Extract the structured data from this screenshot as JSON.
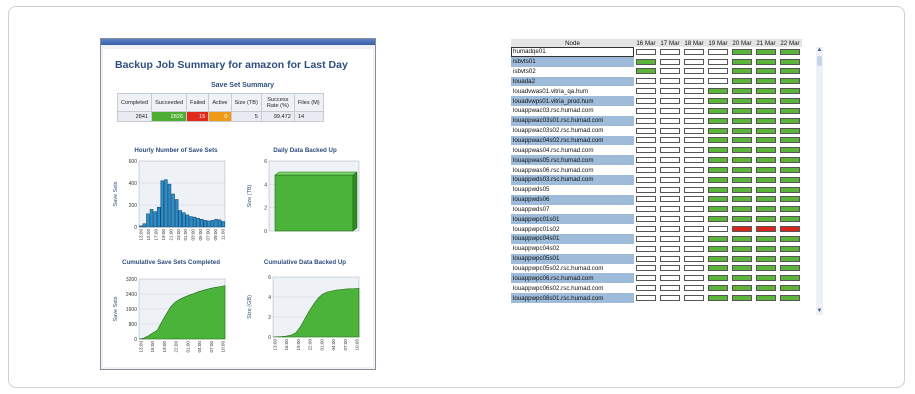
{
  "report": {
    "title": "Backup Job Summary for amazon for Last Day",
    "summary_title": "Save Set Summary",
    "summary_headers": [
      "Completed",
      "Succeeded",
      "Failed",
      "Active",
      "Size (TB)",
      "Success Rate (%)",
      "Files (M)"
    ],
    "summary_values": [
      "2841",
      "2826",
      "15",
      "0",
      "5",
      "99.472",
      "14"
    ],
    "status_colors": {
      "succeeded": "#4cae33",
      "failed": "#e02a1c",
      "active": "#ef9a16"
    }
  },
  "chart_data": [
    {
      "type": "bar",
      "title": "Hourly Number of Save Sets",
      "ylabel": "Save Sets",
      "ylim": [
        0,
        600
      ],
      "yticks": [
        "600",
        "400",
        "200",
        "0"
      ],
      "categories": [
        "13:00",
        "14:00",
        "15:00",
        "16:00",
        "17:00",
        "18:00",
        "19:00",
        "20:00",
        "21:00",
        "22:00",
        "23:00",
        "00:00",
        "01:00",
        "02:00",
        "03:00",
        "04:00",
        "05:00",
        "06:00",
        "07:00",
        "08:00",
        "09:00",
        "10:00",
        "11:00",
        "12:00"
      ],
      "xtick_labels": [
        "13:00",
        "15:00",
        "17:00",
        "19:00",
        "21:00",
        "23:00",
        "01:00",
        "03:00",
        "05:00",
        "07:00",
        "09:00",
        "11:00"
      ],
      "values": [
        10,
        30,
        120,
        160,
        140,
        180,
        420,
        430,
        390,
        300,
        250,
        150,
        130,
        110,
        95,
        90,
        80,
        70,
        60,
        55,
        60,
        70,
        65,
        50
      ]
    },
    {
      "type": "bar",
      "title": "Daily Data Backed Up",
      "ylabel": "Size (TB)",
      "ylim": [
        0,
        6
      ],
      "yticks": [
        "6",
        "4",
        "2",
        "0"
      ],
      "values": [
        4.8
      ]
    },
    {
      "type": "area",
      "title": "Cumulative Save Sets Completed",
      "ylabel": "Save Sets",
      "ylim": [
        0,
        3200
      ],
      "yticks": [
        "3200",
        "2400",
        "1600",
        "800",
        "0"
      ],
      "xtick_labels": [
        "13:00",
        "16:00",
        "19:00",
        "22:00",
        "01:00",
        "04:00",
        "07:00",
        "10:00"
      ],
      "values": [
        0,
        40,
        160,
        320,
        460,
        900,
        1330,
        1720,
        1970,
        2120,
        2230,
        2330,
        2410,
        2510,
        2580,
        2650,
        2710,
        2760,
        2800,
        2841
      ]
    },
    {
      "type": "area",
      "title": "Cumulative Data Backed Up",
      "ylabel": "Size (GB)",
      "ylim": [
        0,
        6
      ],
      "yticks": [
        "6",
        "4",
        "2",
        "0"
      ],
      "xtick_labels": [
        "13:00",
        "16:00",
        "19:00",
        "22:00",
        "01:00",
        "04:00",
        "07:00",
        "10:00"
      ],
      "values": [
        0,
        0.02,
        0.05,
        0.1,
        0.2,
        0.4,
        1.0,
        1.8,
        2.6,
        3.3,
        3.9,
        4.3,
        4.5,
        4.6,
        4.7,
        4.75,
        4.8,
        4.82,
        4.83,
        4.85
      ]
    }
  ],
  "grid": {
    "node_header": "Node",
    "dates": [
      "16 Mar",
      "17 Mar",
      "18 Mar",
      "19 Mar",
      "20 Mar",
      "21 Mar",
      "22 Mar"
    ],
    "rows": [
      {
        "node": "humadqe01",
        "status": "wwwwggg"
      },
      {
        "node": "isbvts01",
        "status": "gwwwggg"
      },
      {
        "node": "isbvts02",
        "status": "gwwwggg"
      },
      {
        "node": "louada2",
        "status": "wwwwggg"
      },
      {
        "node": "louadvwas01.vitria_qa.hum",
        "status": "wwwgggg"
      },
      {
        "node": "louadvwps01.vitria_prod.hum",
        "status": "wwwgggg"
      },
      {
        "node": "louappwac03.rsc.humad.com",
        "status": "wwwgggg"
      },
      {
        "node": "louappwac03s01.rsc.humad.com",
        "status": "wwwgggg"
      },
      {
        "node": "louappwac03s02.rsc.humad.com",
        "status": "wwwgggg"
      },
      {
        "node": "louappwac04s02.rsc.humad.com",
        "status": "wwwgggg"
      },
      {
        "node": "louappwas04.rsc.humad.com",
        "status": "wwwgggg"
      },
      {
        "node": "louappwas05.rsc.humad.com",
        "status": "wwwgggg"
      },
      {
        "node": "louappwas06.rsc.humad.com",
        "status": "wwwgggg"
      },
      {
        "node": "louappwds03.rsc.humad.com",
        "status": "wwwgggg"
      },
      {
        "node": "louappwds05",
        "status": "wwwgggg"
      },
      {
        "node": "louappwds06",
        "status": "wwwgggg"
      },
      {
        "node": "louappwds07",
        "status": "wwwgggg"
      },
      {
        "node": "louappwpc01s01",
        "status": "wwwgggg"
      },
      {
        "node": "louappwpc01s02",
        "status": "wwwwrrr"
      },
      {
        "node": "louappwpc04s01",
        "status": "wwwgggg"
      },
      {
        "node": "louappwpc04s02",
        "status": "wwwgggg"
      },
      {
        "node": "louappwpc05s01",
        "status": "wwwgggg"
      },
      {
        "node": "louappwpc05s02.rsc.humad.com",
        "status": "wwwgggg"
      },
      {
        "node": "louappwpc06.rsc.humad.com",
        "status": "wwwgggg"
      },
      {
        "node": "louappwpc06s02.rsc.humad.com",
        "status": "wwwgggg"
      },
      {
        "node": "louappwpc08s01.rsc.humad.com",
        "status": "wwwgggg"
      }
    ]
  }
}
